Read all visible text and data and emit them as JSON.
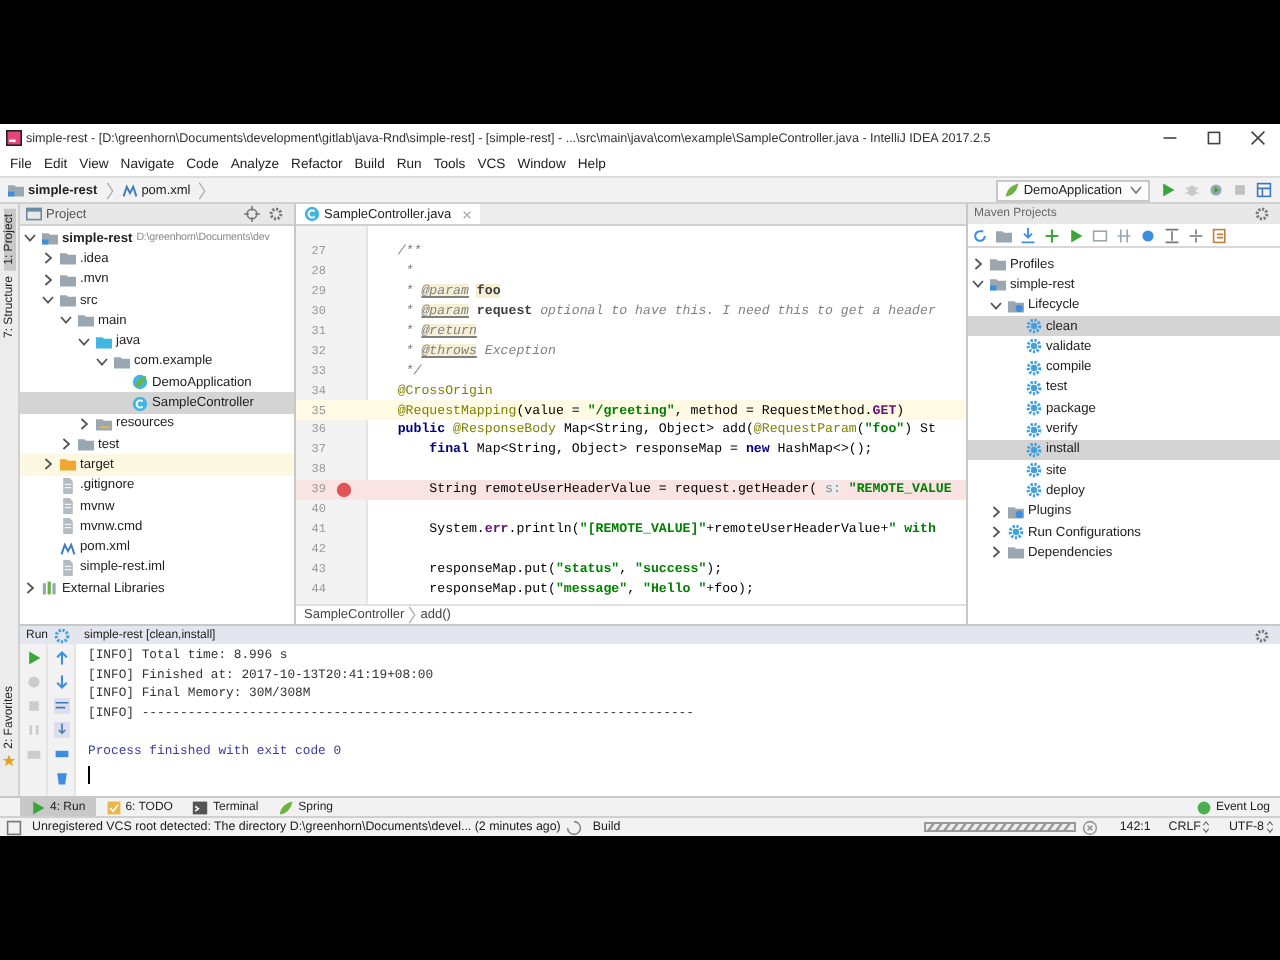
{
  "window": {
    "title": "simple-rest - [D:\\greenhorn\\Documents\\development\\gitlab\\java-Rnd\\simple-rest] - [simple-rest] - ...\\src\\main\\java\\com\\example\\SampleController.java - IntelliJ IDEA 2017.2.5"
  },
  "menu": [
    "File",
    "Edit",
    "View",
    "Navigate",
    "Code",
    "Analyze",
    "Refactor",
    "Build",
    "Run",
    "Tools",
    "VCS",
    "Window",
    "Help"
  ],
  "navbar": [
    {
      "label": "simple-rest",
      "kind": "module"
    },
    {
      "label": "pom.xml",
      "kind": "maven-file"
    }
  ],
  "toolbar": {
    "run_config": "DemoApplication"
  },
  "side_tabs": [
    {
      "label": "1: Project",
      "selected": true
    },
    {
      "label": "7: Structure",
      "selected": false
    }
  ],
  "favorites_tab": "2: Favorites",
  "project_panel": {
    "title": "Project",
    "tree": [
      {
        "label": "simple-rest",
        "note": "D:\\greenhorn\\Documents\\dev",
        "kind": "module",
        "expanded": true,
        "selected": false,
        "children": [
          {
            "label": ".idea",
            "kind": "folder",
            "expanded": false,
            "selected": false
          },
          {
            "label": ".mvn",
            "kind": "folder",
            "expanded": false,
            "selected": false
          },
          {
            "label": "src",
            "kind": "folder",
            "expanded": true,
            "selected": false,
            "children": [
              {
                "label": "main",
                "kind": "folder",
                "expanded": true,
                "selected": false,
                "children": [
                  {
                    "label": "java",
                    "kind": "source-folder",
                    "expanded": true,
                    "selected": false,
                    "children": [
                      {
                        "label": "com.example",
                        "kind": "package",
                        "expanded": true,
                        "selected": false,
                        "children": [
                          {
                            "label": "DemoApplication",
                            "kind": "spring-class",
                            "selected": false
                          },
                          {
                            "label": "SampleController",
                            "kind": "class",
                            "selected": true
                          }
                        ]
                      }
                    ]
                  },
                  {
                    "label": "resources",
                    "kind": "resources-folder",
                    "expanded": false,
                    "selected": false
                  }
                ]
              },
              {
                "label": "test",
                "kind": "folder",
                "expanded": false,
                "selected": false
              }
            ]
          },
          {
            "label": "target",
            "kind": "excluded-folder",
            "expanded": false,
            "selected": false
          },
          {
            "label": ".gitignore",
            "kind": "file",
            "selected": false
          },
          {
            "label": "mvnw",
            "kind": "file",
            "selected": false
          },
          {
            "label": "mvnw.cmd",
            "kind": "file",
            "selected": false
          },
          {
            "label": "pom.xml",
            "kind": "maven-file",
            "selected": false
          },
          {
            "label": "simple-rest.iml",
            "kind": "file",
            "selected": false
          }
        ]
      },
      {
        "label": "External Libraries",
        "kind": "libraries",
        "expanded": false,
        "selected": false
      }
    ]
  },
  "editor": {
    "tabs": [
      {
        "label": "SampleController.java",
        "selected": true
      }
    ],
    "lines": [
      {
        "number": "27",
        "current": false,
        "breakpoint": false,
        "segments": [
          {
            "text": "    /**",
            "kind": "comment"
          }
        ]
      },
      {
        "number": "28",
        "current": false,
        "breakpoint": false,
        "segments": [
          {
            "text": "     *",
            "kind": "comment"
          }
        ]
      },
      {
        "number": "29",
        "current": false,
        "breakpoint": false,
        "segments": [
          {
            "text": "     * ",
            "kind": "comment"
          },
          {
            "text": "@param",
            "kind": "doctag"
          },
          {
            "text": "foo",
            "kind": "docparam"
          }
        ]
      },
      {
        "number": "30",
        "current": false,
        "breakpoint": false,
        "segments": [
          {
            "text": "     * ",
            "kind": "comment"
          },
          {
            "text": "@param",
            "kind": "doctag"
          },
          {
            "text": "request",
            "kind": "docname"
          },
          {
            "text": " optional to have this. I need this to get a header",
            "kind": "comment"
          }
        ]
      },
      {
        "number": "31",
        "current": false,
        "breakpoint": false,
        "segments": [
          {
            "text": "     * ",
            "kind": "comment"
          },
          {
            "text": "@return",
            "kind": "doctag"
          }
        ]
      },
      {
        "number": "32",
        "current": false,
        "breakpoint": false,
        "segments": [
          {
            "text": "     * ",
            "kind": "comment"
          },
          {
            "text": "@throws",
            "kind": "doctag"
          },
          {
            "text": " Exception",
            "kind": "comment"
          }
        ]
      },
      {
        "number": "33",
        "current": false,
        "breakpoint": false,
        "segments": [
          {
            "text": "     */",
            "kind": "comment"
          }
        ]
      },
      {
        "number": "34",
        "current": false,
        "breakpoint": false,
        "segments": [
          {
            "text": "    @CrossOrigin",
            "kind": "annotation"
          }
        ]
      },
      {
        "number": "35",
        "current": true,
        "breakpoint": false,
        "segments": [
          {
            "text": "    @RequestMapping",
            "kind": "annotation"
          },
          {
            "text": "(value = ",
            "kind": "plain"
          },
          {
            "text": "\"/greeting\"",
            "kind": "string"
          },
          {
            "text": ", method = RequestMethod.",
            "kind": "plain"
          },
          {
            "text": "GET",
            "kind": "field"
          },
          {
            "text": ")",
            "kind": "plain"
          }
        ]
      },
      {
        "number": "36",
        "current": false,
        "breakpoint": false,
        "segments": [
          {
            "text": "    public",
            "kind": "keyword"
          },
          {
            "text": " @ResponseBody",
            "kind": "annotation"
          },
          {
            "text": " Map<String, Object> add(",
            "kind": "plain"
          },
          {
            "text": "@RequestParam",
            "kind": "annotation"
          },
          {
            "text": "(",
            "kind": "plain"
          },
          {
            "text": "\"foo\"",
            "kind": "string"
          },
          {
            "text": ") St",
            "kind": "plain"
          }
        ]
      },
      {
        "number": "37",
        "current": false,
        "breakpoint": false,
        "segments": [
          {
            "text": "        final",
            "kind": "keyword"
          },
          {
            "text": " Map<String, Object> responseMap = ",
            "kind": "plain"
          },
          {
            "text": "new",
            "kind": "keyword"
          },
          {
            "text": " HashMap<>();",
            "kind": "plain"
          }
        ]
      },
      {
        "number": "38",
        "current": false,
        "breakpoint": false
      },
      {
        "number": "39",
        "current": false,
        "breakpoint": true,
        "segments": [
          {
            "text": "        String remoteUserHeaderValue = request.getHeader( ",
            "kind": "plain"
          },
          {
            "text": "s:",
            "kind": "hint"
          },
          {
            "text": " \"REMOTE_VALUE",
            "kind": "string"
          }
        ]
      },
      {
        "number": "40",
        "current": false,
        "breakpoint": false
      },
      {
        "number": "41",
        "current": false,
        "breakpoint": false,
        "segments": [
          {
            "text": "        System.",
            "kind": "plain"
          },
          {
            "text": "err",
            "kind": "field"
          },
          {
            "text": ".println(",
            "kind": "plain"
          },
          {
            "text": "\"[REMOTE_VALUE]\"",
            "kind": "string"
          },
          {
            "text": "+remoteUserHeaderValue+",
            "kind": "plain"
          },
          {
            "text": "\" with",
            "kind": "string"
          }
        ]
      },
      {
        "number": "42",
        "current": false,
        "breakpoint": false
      },
      {
        "number": "43",
        "current": false,
        "breakpoint": false,
        "segments": [
          {
            "text": "        responseMap.put(",
            "kind": "plain"
          },
          {
            "text": "\"status\"",
            "kind": "string"
          },
          {
            "text": ", ",
            "kind": "plain"
          },
          {
            "text": "\"success\"",
            "kind": "string"
          },
          {
            "text": ");",
            "kind": "plain"
          }
        ]
      },
      {
        "number": "44",
        "current": false,
        "breakpoint": false,
        "segments": [
          {
            "text": "        responseMap.put(",
            "kind": "plain"
          },
          {
            "text": "\"message\"",
            "kind": "string"
          },
          {
            "text": ", ",
            "kind": "plain"
          },
          {
            "text": "\"Hello \"",
            "kind": "string"
          },
          {
            "text": "+foo);",
            "kind": "plain"
          }
        ]
      }
    ],
    "breadcrumbs": [
      "SampleController",
      "add()"
    ]
  },
  "maven_panel": {
    "title": "Maven Projects",
    "tree": [
      {
        "label": "Profiles",
        "kind": "folder",
        "expanded": false,
        "selected": false
      },
      {
        "label": "simple-rest",
        "kind": "module",
        "expanded": true,
        "selected": false,
        "children": [
          {
            "label": "Lifecycle",
            "kind": "lifecycle",
            "expanded": true,
            "selected": false,
            "children": [
              {
                "label": "clean",
                "kind": "goal",
                "selected": true
              },
              {
                "label": "validate",
                "kind": "goal",
                "selected": false
              },
              {
                "label": "compile",
                "kind": "goal",
                "selected": false
              },
              {
                "label": "test",
                "kind": "goal",
                "selected": false
              },
              {
                "label": "package",
                "kind": "goal",
                "selected": false
              },
              {
                "label": "verify",
                "kind": "goal",
                "selected": false
              },
              {
                "label": "install",
                "kind": "goal",
                "selected": true
              },
              {
                "label": "site",
                "kind": "goal",
                "selected": false
              },
              {
                "label": "deploy",
                "kind": "goal",
                "selected": false
              }
            ]
          },
          {
            "label": "Plugins",
            "kind": "lifecycle",
            "expanded": false,
            "selected": false
          },
          {
            "label": "Run Configurations",
            "kind": "goal",
            "expanded": false,
            "selected": false
          },
          {
            "label": "Dependencies",
            "kind": "folder",
            "expanded": false,
            "selected": false
          }
        ]
      }
    ]
  },
  "run_panel": {
    "label": "Run",
    "config": "simple-rest [clean,install]",
    "console": [
      {
        "text": "[INFO] Total time: 8.996 s",
        "kind": "log"
      },
      {
        "text": "[INFO] Finished at: 2017-10-13T20:41:19+08:00",
        "kind": "log"
      },
      {
        "text": "[INFO] Final Memory: 30M/308M",
        "kind": "log"
      },
      {
        "text": "[INFO] ------------------------------------------------------------------------",
        "kind": "log"
      },
      {
        "text": "Process finished with exit code 0",
        "kind": "exit"
      }
    ]
  },
  "tool_tabs": [
    {
      "label": "4: Run",
      "kind": "run",
      "selected": true
    },
    {
      "label": "6: TODO",
      "kind": "todo",
      "selected": false
    },
    {
      "label": "Terminal",
      "kind": "terminal",
      "selected": false
    },
    {
      "label": "Spring",
      "kind": "spring",
      "selected": false
    }
  ],
  "event_log": "Event Log",
  "status_bar": {
    "message": "Unregistered VCS root detected: The directory D:\\greenhorn\\Documents\\devel... (2 minutes ago)",
    "build": "Build",
    "position": "142:1",
    "line_separator": "CRLF",
    "encoding": "UTF-8"
  }
}
